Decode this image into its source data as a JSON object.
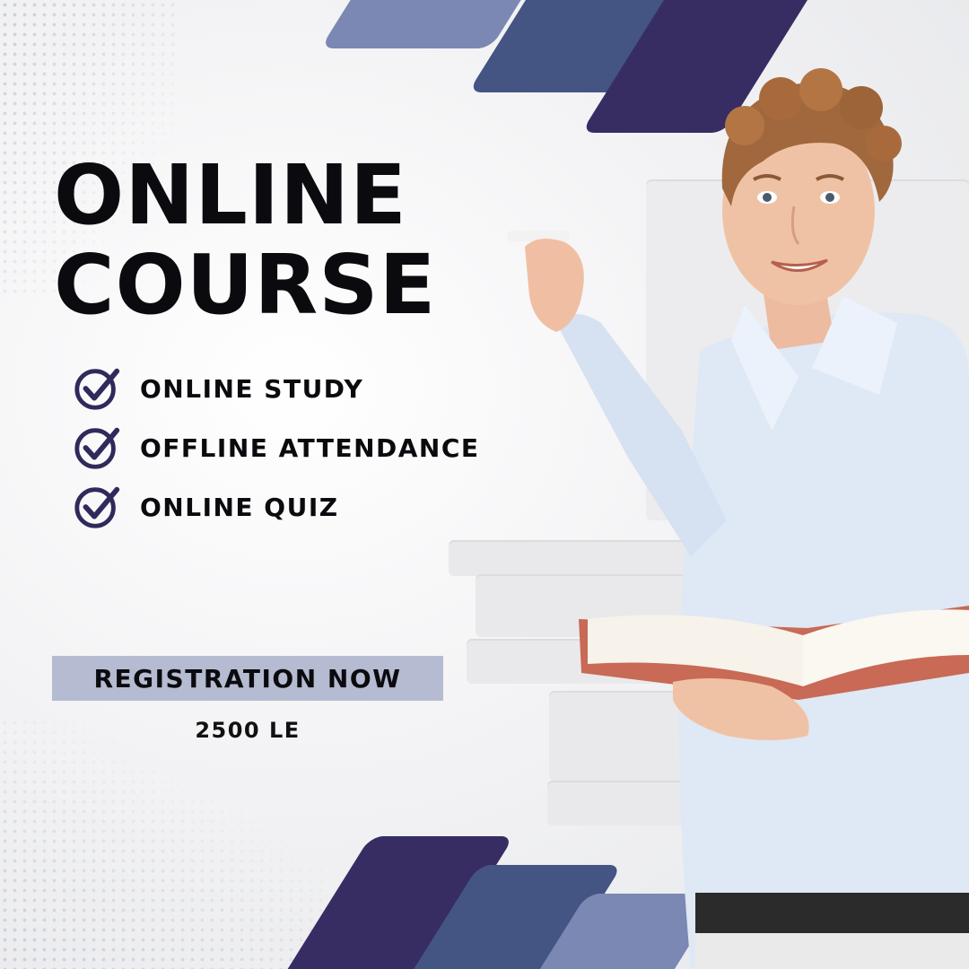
{
  "title": {
    "line1": "ONLINE",
    "line2": "COURSE"
  },
  "features": [
    {
      "label": "ONLINE STUDY",
      "icon": "check-circle-icon"
    },
    {
      "label": "OFFLINE ATTENDANCE",
      "icon": "check-circle-icon"
    },
    {
      "label": "ONLINE QUIZ",
      "icon": "check-circle-icon"
    }
  ],
  "cta": {
    "label": "REGISTRATION NOW"
  },
  "price": {
    "label": "2500 LE"
  },
  "colors": {
    "stripe_light": "#7b88b3",
    "stripe_mid": "#445483",
    "stripe_dark": "#372d63",
    "cta_bg": "#b5bbd0",
    "text": "#0b0b0f"
  }
}
